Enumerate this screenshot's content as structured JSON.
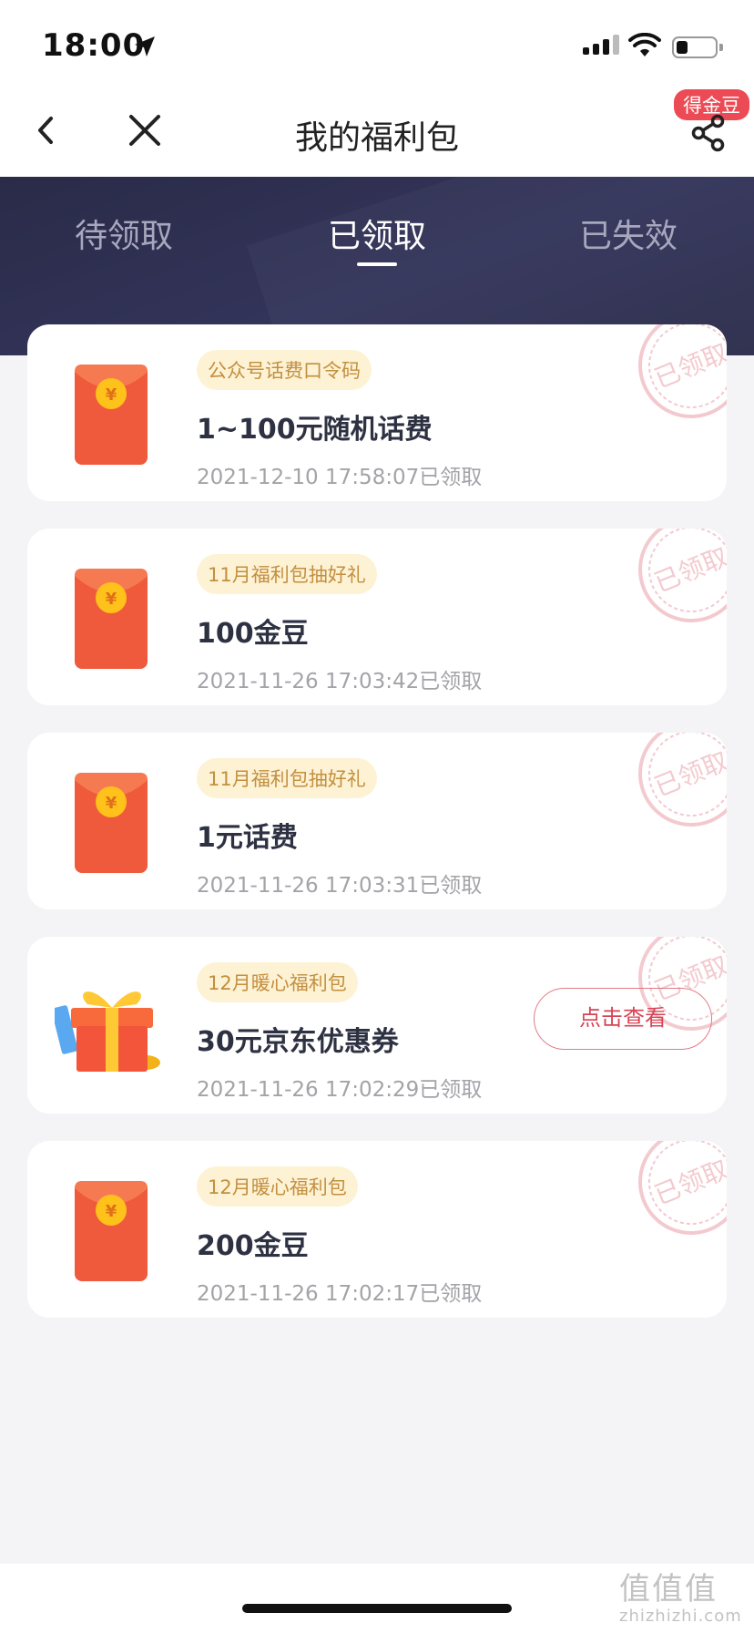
{
  "status_bar": {
    "time": "18:00"
  },
  "nav": {
    "title": "我的福利包",
    "share_badge": "得金豆"
  },
  "tabs": [
    {
      "label": "待领取",
      "active": false
    },
    {
      "label": "已领取",
      "active": true
    },
    {
      "label": "已失效",
      "active": false
    }
  ],
  "stamp_text": "已领取",
  "items": [
    {
      "icon": "red-envelope-icon",
      "tag": "公众号话费口令码",
      "name": "1~100元随机话费",
      "date": "2021-12-10 17:58:07已领取"
    },
    {
      "icon": "red-envelope-icon",
      "tag": "11月福利包抽好礼",
      "name": "100金豆",
      "date": "2021-11-26 17:03:42已领取"
    },
    {
      "icon": "red-envelope-icon",
      "tag": "11月福利包抽好礼",
      "name": "1元话费",
      "date": "2021-11-26 17:03:31已领取"
    },
    {
      "icon": "gift-box-icon",
      "tag": "12月暖心福利包",
      "name": "30元京东优惠券",
      "date": "2021-11-26 17:02:29已领取",
      "action": "点击查看"
    },
    {
      "icon": "red-envelope-icon",
      "tag": "12月暖心福利包",
      "name": "200金豆",
      "date": "2021-11-26 17:02:17已领取"
    }
  ],
  "watermark": {
    "top": "值值值",
    "bottom": "zhizhizhi.com"
  },
  "colors": {
    "header_bg": "#2a2b48",
    "accent_red": "#d64456",
    "envelope": "#ef5a3c",
    "coin": "#ffc21a",
    "tag_bg": "#fdf2d4"
  }
}
